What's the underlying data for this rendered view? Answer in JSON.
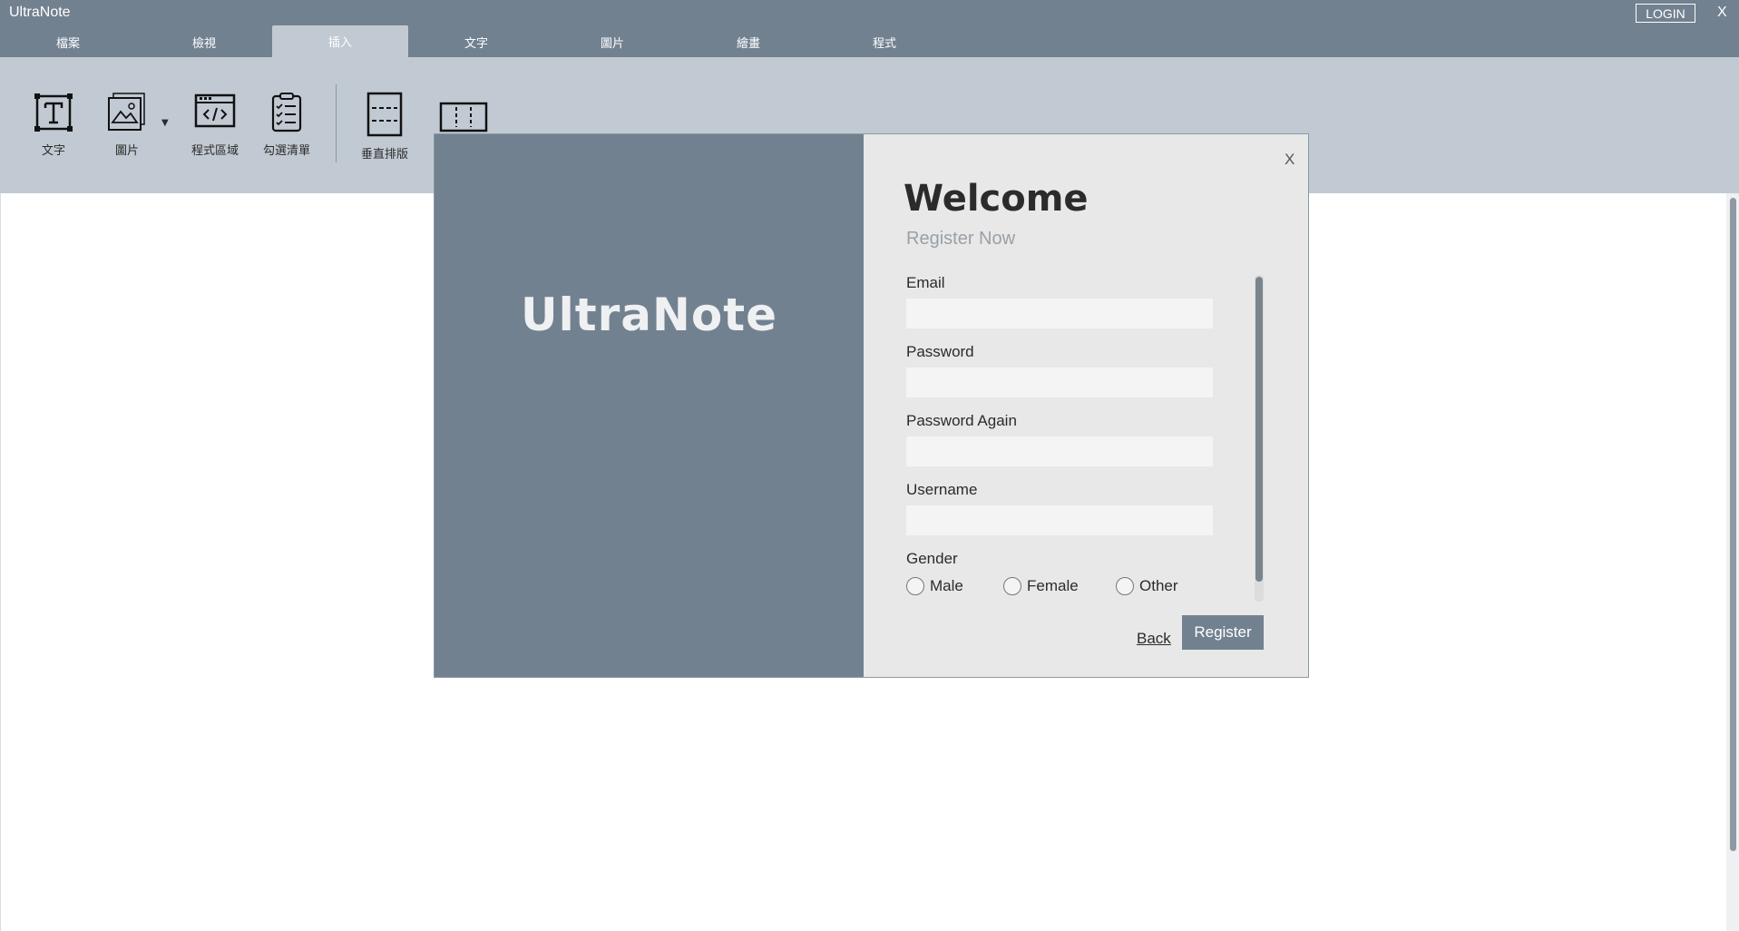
{
  "window": {
    "title": "UltraNote",
    "login_label": "LOGIN",
    "close_label": "X"
  },
  "tabs": [
    {
      "label": "檔案"
    },
    {
      "label": "檢視"
    },
    {
      "label": "插入",
      "active": true
    },
    {
      "label": "文字"
    },
    {
      "label": "圖片"
    },
    {
      "label": "繪畫"
    },
    {
      "label": "程式"
    }
  ],
  "ribbon": {
    "tools": [
      {
        "label": "文字",
        "icon": "text-box-icon"
      },
      {
        "label": "圖片",
        "icon": "image-icon"
      },
      {
        "label": "程式區域",
        "icon": "code-window-icon"
      },
      {
        "label": "勾選清單",
        "icon": "checklist-icon"
      },
      {
        "label": "垂直排版",
        "icon": "vertical-layout-icon"
      },
      {
        "label": "",
        "icon": "horizontal-layout-icon"
      }
    ]
  },
  "modal": {
    "brand": "UltraNote",
    "close_label": "X",
    "title": "Welcome",
    "subtitle": "Register Now",
    "fields": [
      {
        "label": "Email",
        "value": ""
      },
      {
        "label": "Password",
        "value": ""
      },
      {
        "label": "Password Again",
        "value": ""
      },
      {
        "label": "Username",
        "value": ""
      }
    ],
    "gender": {
      "label": "Gender",
      "options": [
        "Male",
        "Female",
        "Other"
      ]
    },
    "back_label": "Back",
    "register_label": "Register"
  },
  "colors": {
    "header": "#728190",
    "ribbon": "#c1cad2",
    "modal_right": "#e8e8e8",
    "button": "#728190"
  }
}
